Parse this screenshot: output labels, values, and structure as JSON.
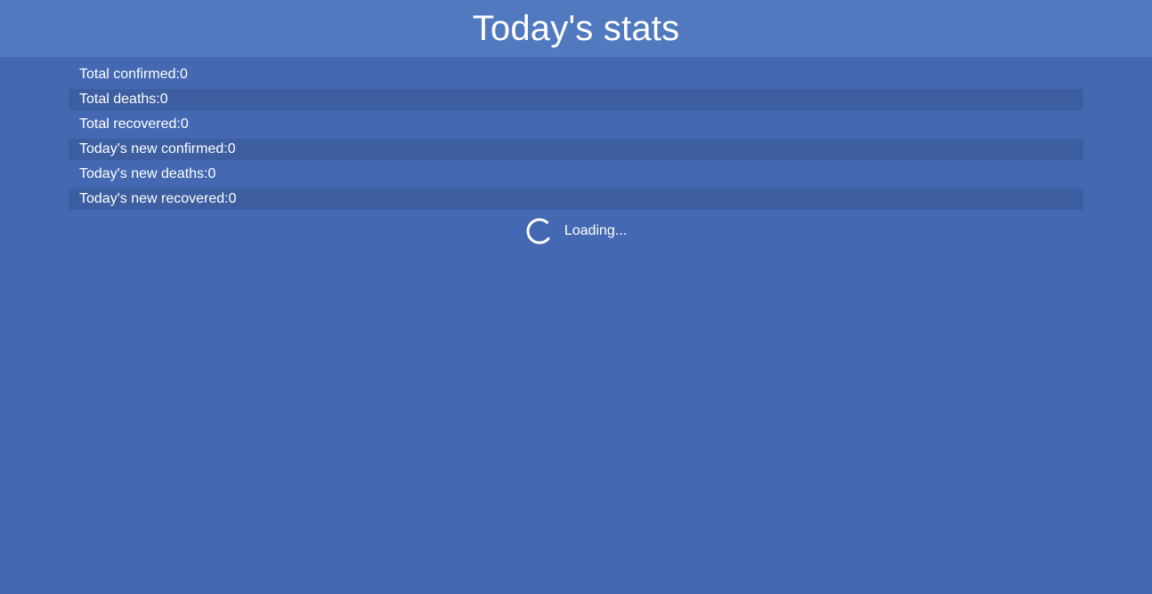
{
  "header": {
    "title": "Today's stats"
  },
  "stats": [
    {
      "label": "Total confirmed:",
      "value": "0"
    },
    {
      "label": "Total deaths:",
      "value": "0"
    },
    {
      "label": "Total recovered:",
      "value": "0"
    },
    {
      "label": "Today's new confirmed:",
      "value": "0"
    },
    {
      "label": "Today's new deaths:",
      "value": "0"
    },
    {
      "label": "Today's new recovered:",
      "value": "0"
    }
  ],
  "loading": {
    "text": "Loading...",
    "icon": "spinner-icon"
  },
  "colors": {
    "background": "#4469b2",
    "header": "#5179c0",
    "alt_row": "#3d5ea1",
    "text": "#ffffff"
  }
}
